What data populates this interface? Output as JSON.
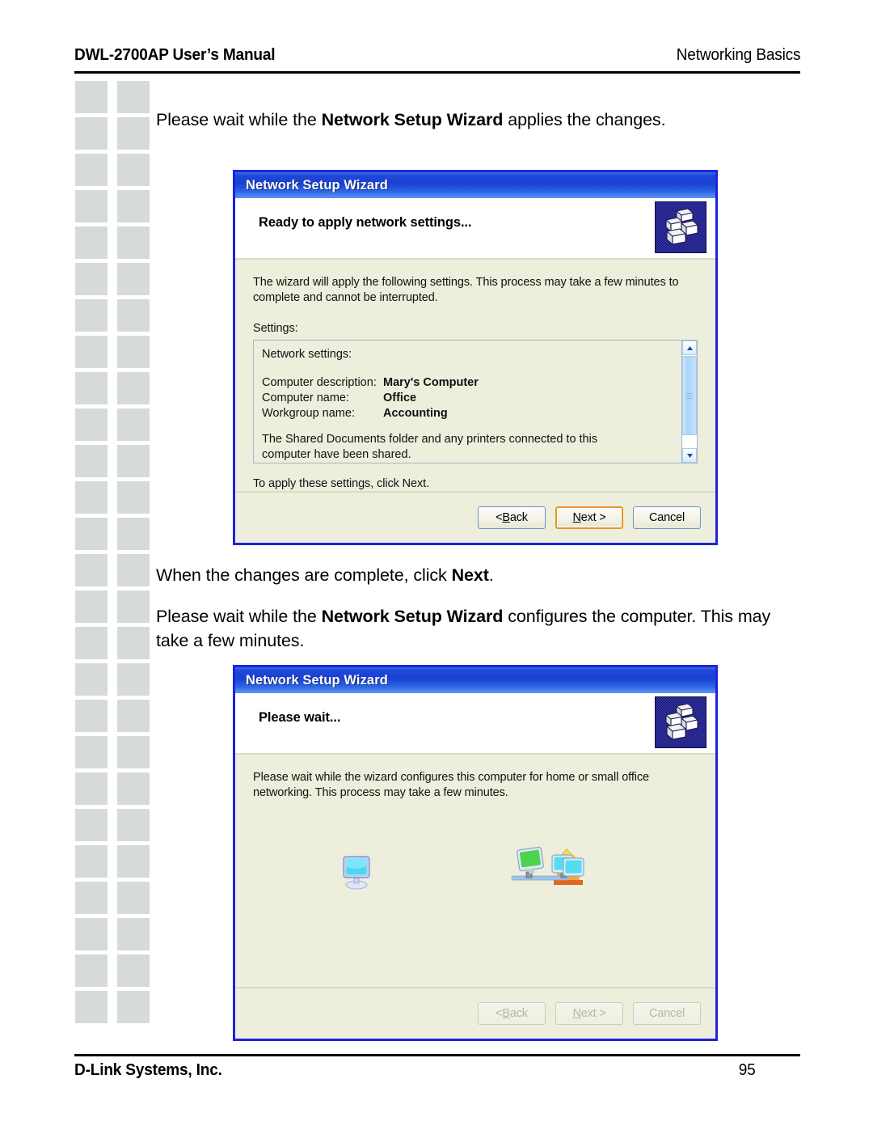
{
  "page": {
    "header_left": "DWL-2700AP User’s Manual",
    "header_right": "Networking Basics",
    "footer_left": "D-Link Systems, Inc.",
    "footer_right": "95"
  },
  "body_text": {
    "para_1_before": "Please wait while the ",
    "para_1_bold": "Network Setup Wizard",
    "para_1_after": " applies the changes.",
    "para_2_before": "When the changes are complete, click ",
    "para_2_bold": "Next",
    "para_2_after": ".",
    "para_3_before": "Please wait while the ",
    "para_3_bold": "Network Setup Wizard",
    "para_3_after": " configures the computer. This may take a few minutes."
  },
  "wizard_apply": {
    "title": "Network Setup Wizard",
    "heading": "Ready to apply network settings...",
    "icon_name": "network-computers-icon",
    "intro": "The wizard will apply the following settings. This process may take a few minutes to complete and cannot be interrupted.",
    "settings_label": "Settings:",
    "list_title": "Network settings:",
    "rows": [
      {
        "key": "Computer description:",
        "value": "Mary's Computer"
      },
      {
        "key": "Computer name:",
        "value": "Office"
      },
      {
        "key": "Workgroup name:",
        "value": "Accounting"
      }
    ],
    "shared_note": "The Shared Documents folder and any printers connected to this computer have been shared.",
    "apply_note": "To apply these settings, click Next.",
    "buttons": {
      "back": "< Back",
      "back_pre": "< ",
      "back_accel": "B",
      "back_post": "ack",
      "next_pre": "",
      "next_accel": "N",
      "next_post": "ext >",
      "cancel": "Cancel"
    },
    "scrollbar": {
      "up_arrow": "scroll-up",
      "down_arrow": "scroll-down"
    }
  },
  "wizard_wait": {
    "title": "Network Setup Wizard",
    "heading": "Please wait...",
    "icon_name": "network-computers-icon",
    "intro": "Please wait while the wizard configures this computer for home or small office networking. This process may take a few minutes.",
    "animation": {
      "left_icon": "computer-monitor-icon",
      "right_icon": "home-network-icon"
    },
    "buttons": {
      "back_pre": "< ",
      "back_accel": "B",
      "back_post": "ack",
      "next_pre": "",
      "next_accel": "N",
      "next_post": "ext >",
      "cancel": "Cancel"
    }
  },
  "colors": {
    "titlebar_blue": "#1f49d8",
    "dialog_border": "#1f22e0",
    "dialog_face": "#edeedc",
    "default_button_focus": "#e8962a",
    "deco_square": "#d6dadb"
  }
}
